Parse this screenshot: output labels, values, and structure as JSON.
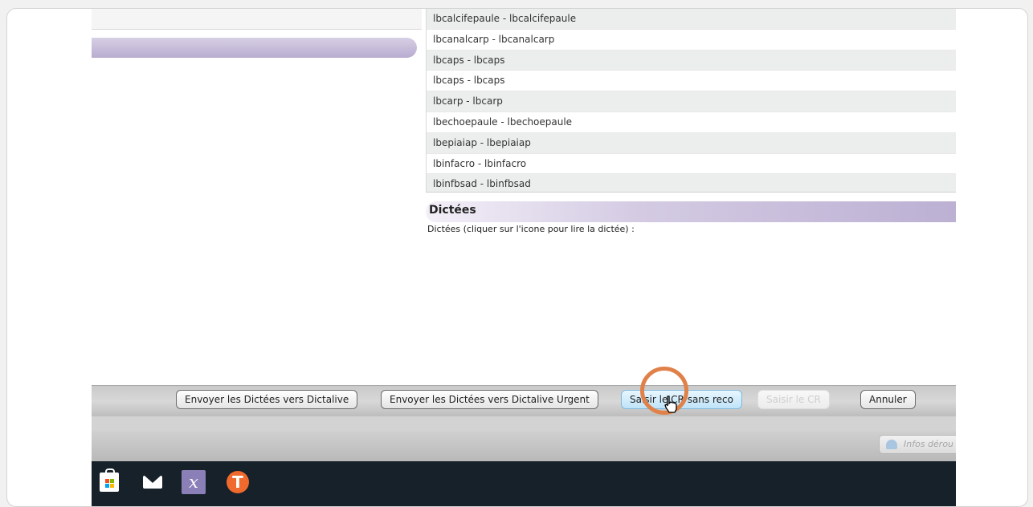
{
  "list": {
    "items": [
      "lbcalcifepaule - lbcalcifepaule",
      "lbcanalcarp - lbcanalcarp",
      "lbcaps - lbcaps",
      "lbcaps - lbcaps",
      "lbcarp - lbcarp",
      "lbechoepaule - lbechoepaule",
      "lbepiaiap - lbepiaiap",
      "lbinfacro - lbinfacro",
      "lbinfbsad - lbinfbsad"
    ]
  },
  "dictees": {
    "title": "Dictées",
    "description": "Dictées (cliquer sur l'icone pour lire la dictée) :"
  },
  "actions": {
    "send": "Envoyer les Dictées vers Dictalive",
    "send_urgent": "Envoyer les Dictées vers Dictalive Urgent",
    "enter_no_reco": "Saisir le CR sans reco",
    "enter": "Saisir le CR",
    "cancel": "Annuler"
  },
  "ticker": {
    "label": "Infos dérou"
  },
  "taskbar": {
    "apps": [
      "store-icon",
      "mail-icon",
      "x-app-icon",
      "t-app-icon"
    ],
    "x_app_glyph": "x",
    "t_app_glyph": "T"
  },
  "colors": {
    "accent_lavender": "#b8acd0",
    "highlight_circle": "#e0814a",
    "active_button": "#bfe3f8",
    "taskbar": "#16212a"
  }
}
